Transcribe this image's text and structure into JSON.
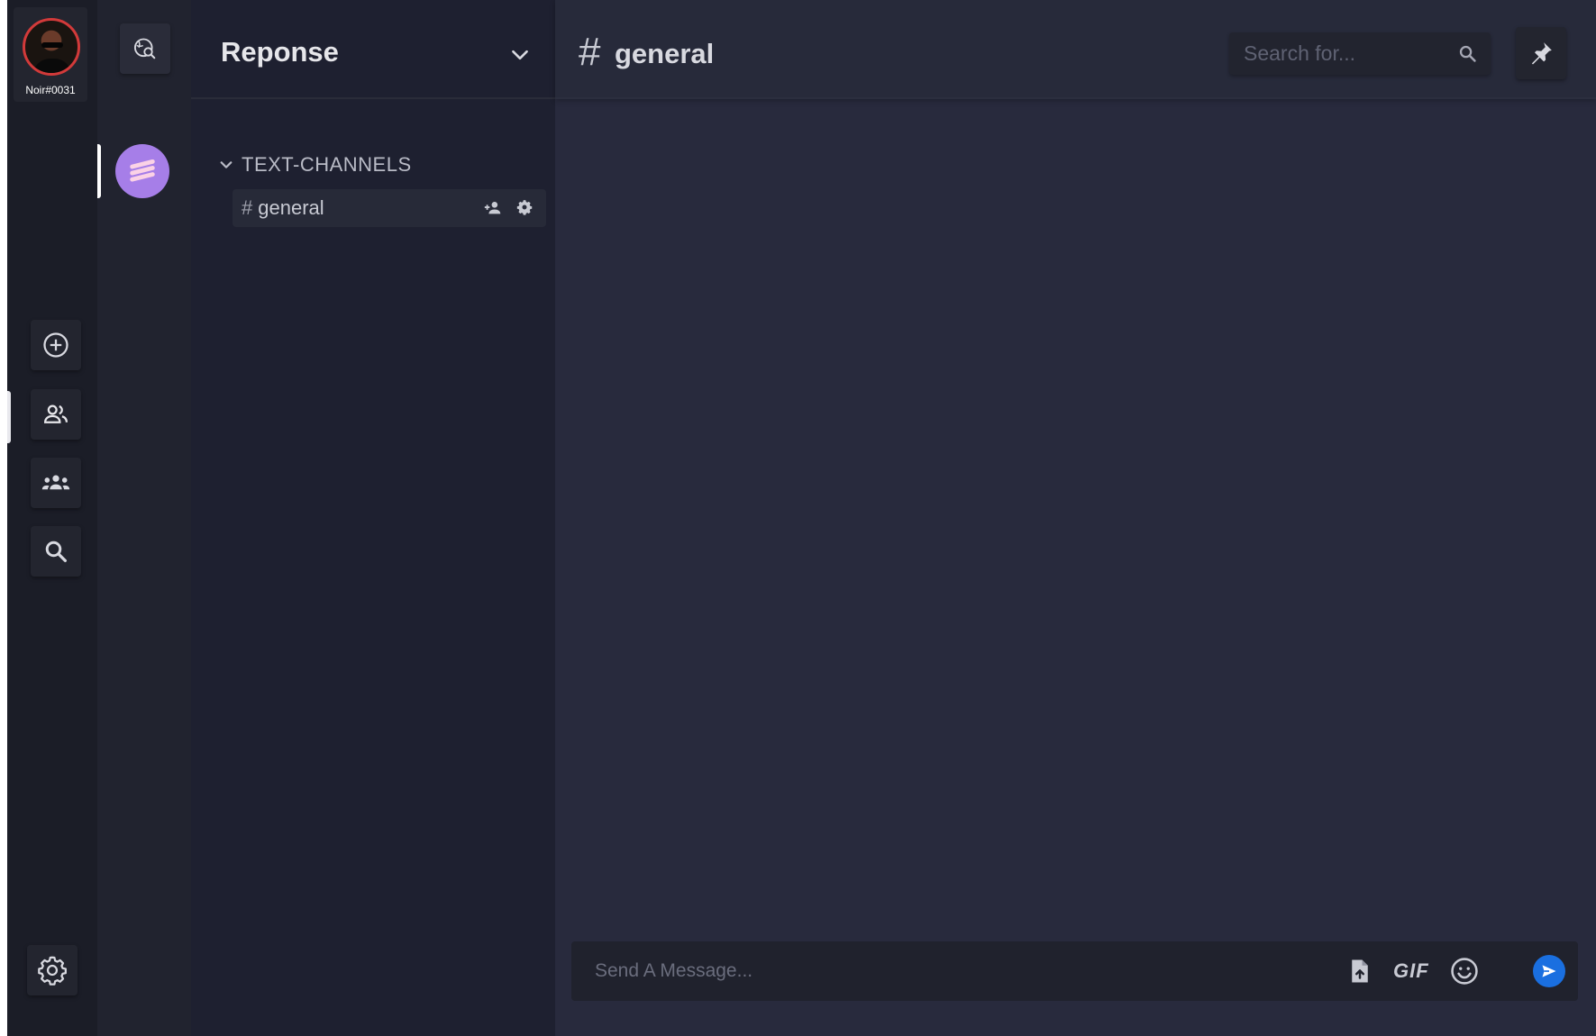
{
  "user": {
    "tag": "Noir#0031"
  },
  "server": {
    "name": "Reponse"
  },
  "channels": {
    "category": "TEXT-CHANNELS",
    "items": [
      {
        "name": "general"
      }
    ]
  },
  "main": {
    "channel_hash": "#",
    "channel_name": "general",
    "search_placeholder": "Search for...",
    "composer_placeholder": "Send A Message...",
    "gif_label": "GIF"
  },
  "colors": {
    "accent": "#1a6fe0",
    "server_icon": "#a67ee8",
    "avatar_ring": "#d23a3a"
  },
  "icons": {
    "rail": [
      "add-circle-icon",
      "friends-icon",
      "groups-icon",
      "search-icon",
      "settings-gear-icon"
    ],
    "discover": "explore-search-icon",
    "header": [
      "search-icon",
      "pin-icon"
    ],
    "composer": [
      "upload-file-icon",
      "gif-icon",
      "emoji-icon",
      "send-icon"
    ],
    "channel_actions": [
      "invite-user-icon",
      "channel-settings-icon"
    ]
  }
}
